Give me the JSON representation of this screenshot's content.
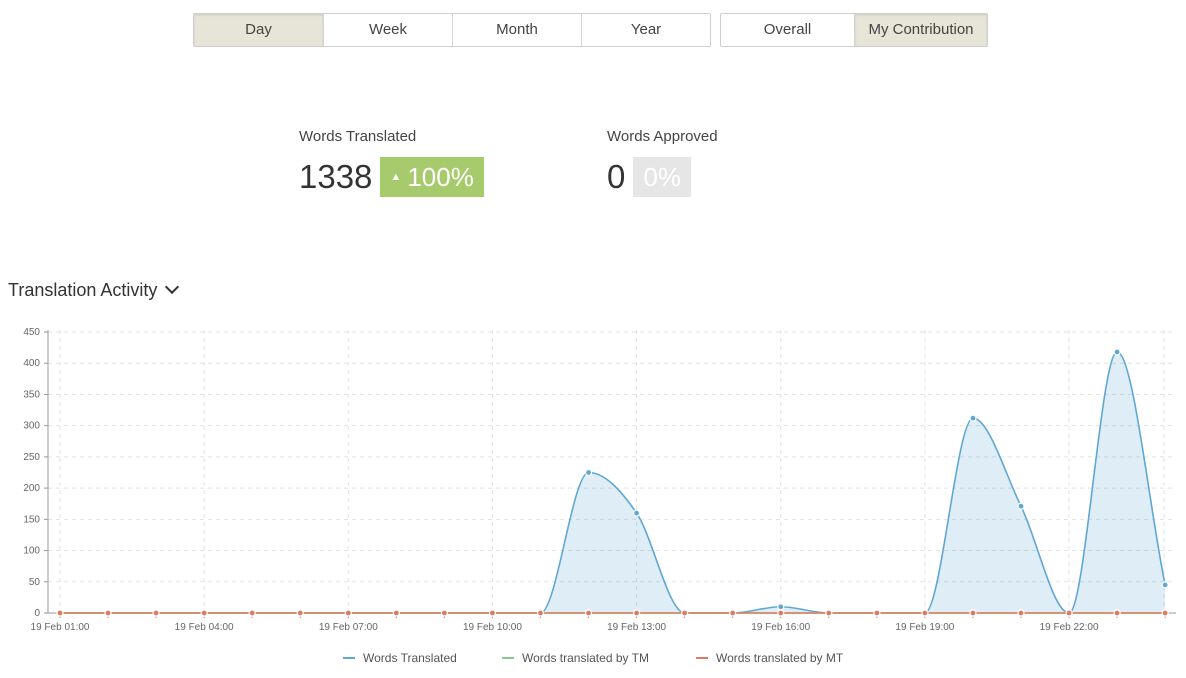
{
  "filters": {
    "range": [
      {
        "label": "Day",
        "active": true
      },
      {
        "label": "Week",
        "active": false
      },
      {
        "label": "Month",
        "active": false
      },
      {
        "label": "Year",
        "active": false
      }
    ],
    "scope": [
      {
        "label": "Overall",
        "active": false
      },
      {
        "label": "My Contribution",
        "active": true
      }
    ]
  },
  "stats": {
    "translated": {
      "label": "Words Translated",
      "value": "1338",
      "change": "100%"
    },
    "approved": {
      "label": "Words Approved",
      "value": "0",
      "change": "0%"
    }
  },
  "chart_title": "Translation Activity",
  "colors": {
    "translated": "#5fa7d4",
    "tm": "#8cc98e",
    "mt": "#e07a5f",
    "up": "#a6ca6c"
  },
  "chart_data": {
    "type": "area",
    "x": [
      "19 Feb 01:00",
      "19 Feb 02:00",
      "19 Feb 03:00",
      "19 Feb 04:00",
      "19 Feb 05:00",
      "19 Feb 06:00",
      "19 Feb 07:00",
      "19 Feb 08:00",
      "19 Feb 09:00",
      "19 Feb 10:00",
      "19 Feb 11:00",
      "19 Feb 12:00",
      "19 Feb 13:00",
      "19 Feb 14:00",
      "19 Feb 15:00",
      "19 Feb 16:00",
      "19 Feb 17:00",
      "19 Feb 18:00",
      "19 Feb 19:00",
      "19 Feb 20:00",
      "19 Feb 21:00",
      "19 Feb 22:00",
      "19 Feb 23:00",
      "20 Feb 00:00"
    ],
    "x_tick_labels": [
      "19 Feb 01:00",
      "19 Feb 04:00",
      "19 Feb 07:00",
      "19 Feb 10:00",
      "19 Feb 13:00",
      "19 Feb 16:00",
      "19 Feb 19:00",
      "19 Feb 22:00"
    ],
    "ylim": [
      0,
      450
    ],
    "y_ticks": [
      0,
      50,
      100,
      150,
      200,
      250,
      300,
      350,
      400,
      450
    ],
    "grid": true,
    "legend_position": "bottom",
    "series": [
      {
        "name": "Words Translated",
        "values": [
          0,
          0,
          0,
          0,
          0,
          0,
          0,
          0,
          0,
          0,
          0,
          225,
          160,
          0,
          0,
          10,
          0,
          0,
          0,
          312,
          171,
          0,
          418,
          45
        ]
      },
      {
        "name": "Words translated by TM",
        "values": [
          0,
          0,
          0,
          0,
          0,
          0,
          0,
          0,
          0,
          0,
          0,
          0,
          0,
          0,
          0,
          0,
          0,
          0,
          0,
          0,
          0,
          0,
          0,
          0
        ]
      },
      {
        "name": "Words translated by MT",
        "values": [
          0,
          0,
          0,
          0,
          0,
          0,
          0,
          0,
          0,
          0,
          0,
          0,
          0,
          0,
          0,
          0,
          0,
          0,
          0,
          0,
          0,
          0,
          0,
          0
        ]
      }
    ]
  }
}
